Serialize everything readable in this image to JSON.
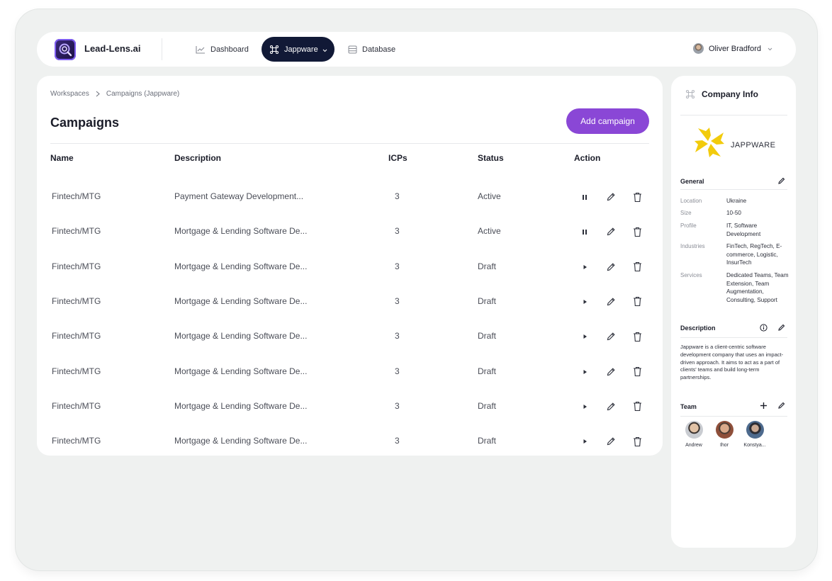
{
  "app": {
    "name": "Lead-Lens.ai"
  },
  "nav": {
    "dashboard": "Dashboard",
    "workspace": "Jappware",
    "database": "Database"
  },
  "user": {
    "name": "Oliver Bradford"
  },
  "breadcrumb": {
    "root": "Workspaces",
    "current": "Campaigns (Jappware)"
  },
  "page": {
    "title": "Campaigns",
    "add_button": "Add campaign"
  },
  "table": {
    "headers": {
      "name": "Name",
      "description": "Description",
      "icps": "ICPs",
      "status": "Status",
      "action": "Action"
    },
    "rows": [
      {
        "name": "Fintech/MTG",
        "description": "Payment Gateway Development...",
        "icps": "3",
        "status": "Active",
        "run_state": "pause"
      },
      {
        "name": "Fintech/MTG",
        "description": "Mortgage & Lending Software De...",
        "icps": "3",
        "status": "Active",
        "run_state": "pause"
      },
      {
        "name": "Fintech/MTG",
        "description": "Mortgage & Lending Software De...",
        "icps": "3",
        "status": "Draft",
        "run_state": "play"
      },
      {
        "name": "Fintech/MTG",
        "description": "Mortgage & Lending Software De...",
        "icps": "3",
        "status": "Draft",
        "run_state": "play"
      },
      {
        "name": "Fintech/MTG",
        "description": "Mortgage & Lending Software De...",
        "icps": "3",
        "status": "Draft",
        "run_state": "play"
      },
      {
        "name": "Fintech/MTG",
        "description": "Mortgage & Lending Software De...",
        "icps": "3",
        "status": "Draft",
        "run_state": "play"
      },
      {
        "name": "Fintech/MTG",
        "description": "Mortgage & Lending Software De...",
        "icps": "3",
        "status": "Draft",
        "run_state": "play"
      },
      {
        "name": "Fintech/MTG",
        "description": "Mortgage & Lending Software De...",
        "icps": "3",
        "status": "Draft",
        "run_state": "play"
      }
    ]
  },
  "company": {
    "panel_title": "Company Info",
    "name": "JAPPWARE",
    "general": {
      "heading": "General",
      "fields": [
        {
          "key": "Location",
          "value": "Ukraine"
        },
        {
          "key": "Size",
          "value": "10-50"
        },
        {
          "key": "Profile",
          "value": "IT, Software Development"
        },
        {
          "key": "Industries",
          "value": "FinTech, RegTech, E-commerce, Logistic, InsurTech"
        },
        {
          "key": "Services",
          "value": "Dedicated Teams, Team Extension, Team Augmentation, Consulting, Support"
        }
      ]
    },
    "description": {
      "heading": "Description",
      "text": "Jappware is a client-centric software development company that uses an impact-driven approach. It aims to act as a part of clients' teams and build long-term partnerships."
    },
    "team": {
      "heading": "Team",
      "members": [
        "Andrew",
        "Ihor",
        "Konstya..."
      ]
    }
  },
  "colors": {
    "accent": "#8a47d6",
    "nav_active": "#111936",
    "logo_yellow": "#f2cb0c"
  }
}
